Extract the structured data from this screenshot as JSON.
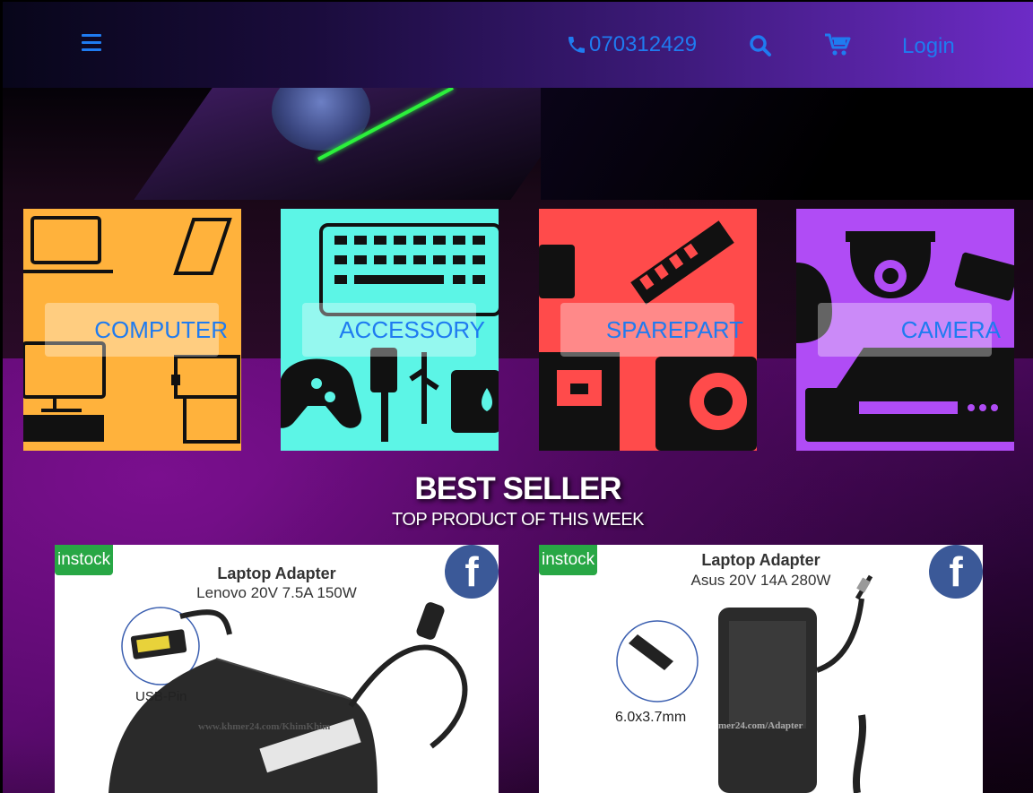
{
  "header": {
    "phone": "070312429",
    "login_label": "Login",
    "accent_color": "#1f7bf0"
  },
  "categories": [
    {
      "label": "COMPUTER",
      "color": "#ffb23c"
    },
    {
      "label": "ACCESSORY",
      "color": "#5cf5e6"
    },
    {
      "label": "SPAREPART",
      "color": "#ff4b4b"
    },
    {
      "label": "CAMERA",
      "color": "#b04cf5"
    }
  ],
  "best_seller": {
    "title": "BEST SELLER",
    "subtitle": "TOP PRODUCT OF THIS WEEK"
  },
  "products": [
    {
      "badge": "instock",
      "title": "Laptop Adapter",
      "spec": "Lenovo 20V 7.5A 150W",
      "pin_label": "USB-Pin",
      "watermark": "www.khmer24.com/KhimKhim"
    },
    {
      "badge": "instock",
      "title": "Laptop Adapter",
      "spec": "Asus 20V 14A 280W",
      "pin_label": "6.0x3.7mm",
      "watermark": "mer24.com/Adapter"
    }
  ]
}
